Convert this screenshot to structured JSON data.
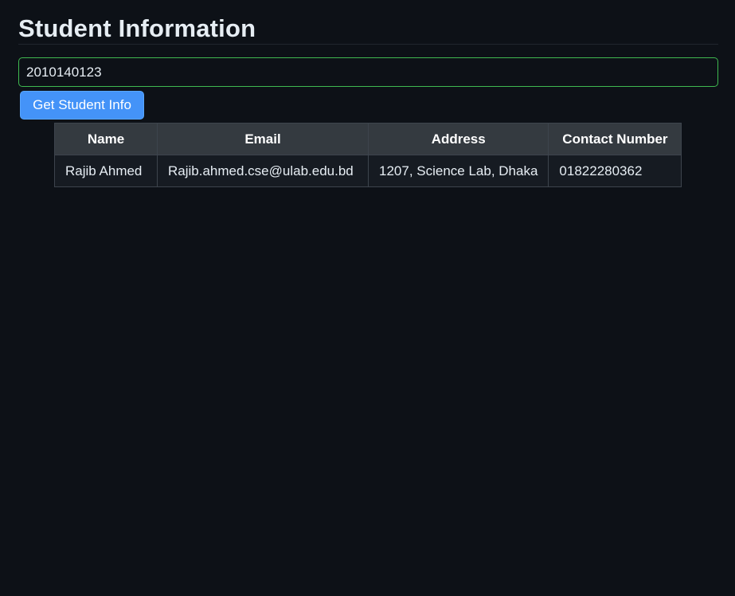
{
  "page": {
    "title": "Student Information"
  },
  "search": {
    "value": "2010140123"
  },
  "actions": {
    "get_info_label": "Get Student Info"
  },
  "table": {
    "headers": [
      "Name",
      "Email",
      "Address",
      "Contact Number"
    ],
    "rows": [
      [
        "Rajib Ahmed",
        "Rajib.ahmed.cse@ulab.edu.bd",
        "1207, Science Lab, Dhaka",
        "01822280362"
      ]
    ]
  },
  "colors": {
    "background": "#0d1117",
    "input_border": "#3fb950",
    "button": "#4493f8",
    "table_header": "#343a40"
  }
}
